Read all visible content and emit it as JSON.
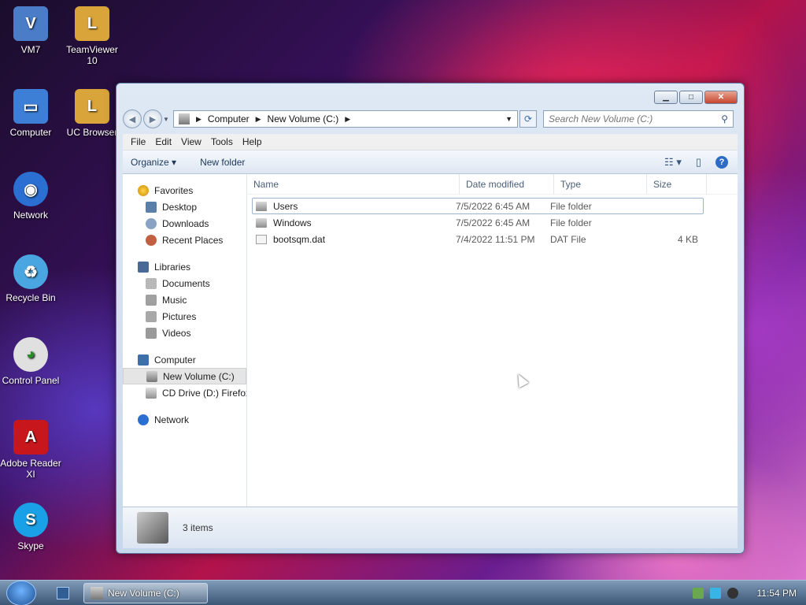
{
  "desktop": {
    "icons": [
      {
        "label": "VM7",
        "color": "#4a7cc8"
      },
      {
        "label": "TeamViewer 10",
        "color": "#d9a43a"
      },
      {
        "label": "Computer",
        "color": "#3d7fd6"
      },
      {
        "label": "UC Browser",
        "color": "#d9a43a"
      },
      {
        "label": "Network",
        "color": "#2a6fd1"
      },
      {
        "label": "Recycle Bin",
        "color": "#4aa6e0"
      },
      {
        "label": "Control Panel",
        "color": "#e0e0e0"
      },
      {
        "label": "Adobe Reader XI",
        "color": "#c8161d"
      },
      {
        "label": "Skype",
        "color": "#1aa0e6"
      }
    ]
  },
  "window": {
    "controls": {
      "minimize": "▁",
      "maximize": "□",
      "close": "✕"
    },
    "address": {
      "crumbs": [
        "Computer",
        "New Volume (C:)"
      ]
    },
    "search": {
      "placeholder": "Search New Volume (C:)"
    },
    "menu": [
      "File",
      "Edit",
      "View",
      "Tools",
      "Help"
    ],
    "toolbar": {
      "organize": "Organize ▾",
      "new_folder": "New folder"
    },
    "nav": {
      "favorites": {
        "label": "Favorites",
        "items": [
          "Desktop",
          "Downloads",
          "Recent Places"
        ]
      },
      "libraries": {
        "label": "Libraries",
        "items": [
          "Documents",
          "Music",
          "Pictures",
          "Videos"
        ]
      },
      "computer": {
        "label": "Computer",
        "items": [
          "New Volume (C:)",
          "CD Drive (D:) Firefox"
        ]
      },
      "network": {
        "label": "Network"
      }
    },
    "columns": {
      "name": "Name",
      "date": "Date modified",
      "type": "Type",
      "size": "Size"
    },
    "files": [
      {
        "name": "Users",
        "date": "7/5/2022 6:45 AM",
        "type": "File folder",
        "size": "",
        "kind": "folder"
      },
      {
        "name": "Windows",
        "date": "7/5/2022 6:45 AM",
        "type": "File folder",
        "size": "",
        "kind": "folder"
      },
      {
        "name": "bootsqm.dat",
        "date": "7/4/2022 11:51 PM",
        "type": "DAT File",
        "size": "4 KB",
        "kind": "file"
      }
    ],
    "status": {
      "items_count": "3 items"
    }
  },
  "taskbar": {
    "task_label": "New Volume (C:)",
    "clock": "11:54 PM"
  }
}
